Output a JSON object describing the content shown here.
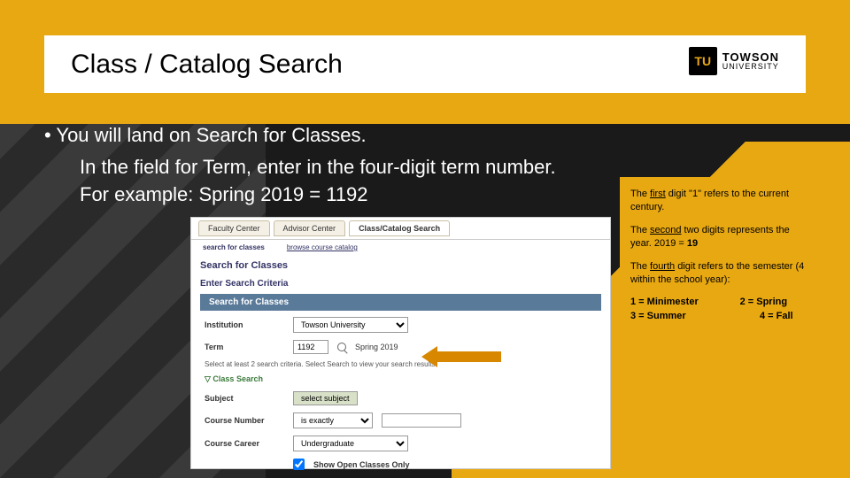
{
  "header": {
    "title": "Class / Catalog Search"
  },
  "logo": {
    "badge": "TU",
    "main": "TOWSON",
    "sub": "UNIVERSITY"
  },
  "content": {
    "bullet": "• You will land on Search for Classes.",
    "line1": "In the field for Term, enter in the four-digit term number.",
    "line2": "For example:  Spring 2019 = 1192"
  },
  "callout": {
    "p1a": "The ",
    "p1u": "first",
    "p1b": " digit \"1\" refers to the current century.",
    "p2a": "The ",
    "p2u": "second",
    "p2b": " two digits represents the year. 2019 = ",
    "p2bold": "19",
    "p3a": "The ",
    "p3u": "fourth",
    "p3b": " digit refers to the semester (4 within the school year):",
    "s1": "1 = Minimester",
    "s2": "2 = Spring",
    "s3": "3 = Summer",
    "s4": "4 = Fall"
  },
  "shot": {
    "tabs": {
      "t1": "Faculty Center",
      "t2": "Advisor Center",
      "t3": "Class/Catalog Search"
    },
    "subtabs": {
      "s1": "search for classes",
      "s2": "browse course catalog"
    },
    "title": "Search for Classes",
    "subtitle": "Enter Search Criteria",
    "bar": "Search for Classes",
    "institution": {
      "label": "Institution",
      "value": "Towson University"
    },
    "term": {
      "label": "Term",
      "value": "1192",
      "display": "Spring 2019"
    },
    "help": "Select at least 2 search criteria. Select Search to view your search results.",
    "expand": "▽ Class Search",
    "subject": {
      "label": "Subject",
      "button": "select subject"
    },
    "course": {
      "label": "Course Number",
      "op": "is exactly"
    },
    "career": {
      "label": "Course Career",
      "value": "Undergraduate"
    },
    "checkbox": "Show Open Classes Only"
  }
}
